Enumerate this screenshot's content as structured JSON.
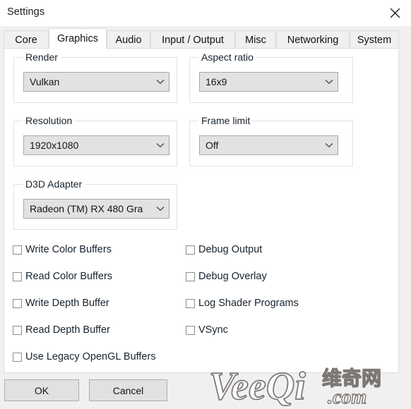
{
  "window": {
    "title": "Settings",
    "close_icon": "close-icon"
  },
  "tabs": [
    {
      "label": "Core",
      "active": false
    },
    {
      "label": "Graphics",
      "active": true
    },
    {
      "label": "Audio",
      "active": false
    },
    {
      "label": "Input / Output",
      "active": false
    },
    {
      "label": "Misc",
      "active": false
    },
    {
      "label": "Networking",
      "active": false
    },
    {
      "label": "System",
      "active": false
    }
  ],
  "graphics": {
    "groups": [
      {
        "label": "Render",
        "value": "Vulkan"
      },
      {
        "label": "Aspect ratio",
        "value": "16x9"
      },
      {
        "label": "Resolution",
        "value": "1920x1080"
      },
      {
        "label": "Frame limit",
        "value": "Off"
      },
      {
        "label": "D3D Adapter",
        "value": "Radeon (TM) RX 480 Gra"
      }
    ],
    "checkboxes_left": [
      {
        "label": "Write Color Buffers",
        "checked": false
      },
      {
        "label": "Read Color Buffers",
        "checked": false
      },
      {
        "label": "Write Depth Buffer",
        "checked": false
      },
      {
        "label": "Read Depth Buffer",
        "checked": false
      },
      {
        "label": "Use Legacy OpenGL Buffers",
        "checked": false
      }
    ],
    "checkboxes_right": [
      {
        "label": "Debug Output",
        "checked": false
      },
      {
        "label": "Debug Overlay",
        "checked": false
      },
      {
        "label": "Log Shader Programs",
        "checked": false
      },
      {
        "label": "VSync",
        "checked": false
      }
    ]
  },
  "footer": {
    "ok_label": "OK",
    "cancel_label": "Cancel"
  },
  "watermark": {
    "text_latin": "VeeQi",
    "text_cjk": "维奇网",
    "text_tld": ".com"
  },
  "colors": {
    "window_bg": "#f0f0f0",
    "panel_bg": "#ffffff",
    "combo_bg": "#e2e2e2",
    "combo_border": "#a8a8a8",
    "group_border": "#e2e2e2",
    "text": "#17232e",
    "button_bg": "#e1e1e1",
    "button_border": "#adadad"
  }
}
